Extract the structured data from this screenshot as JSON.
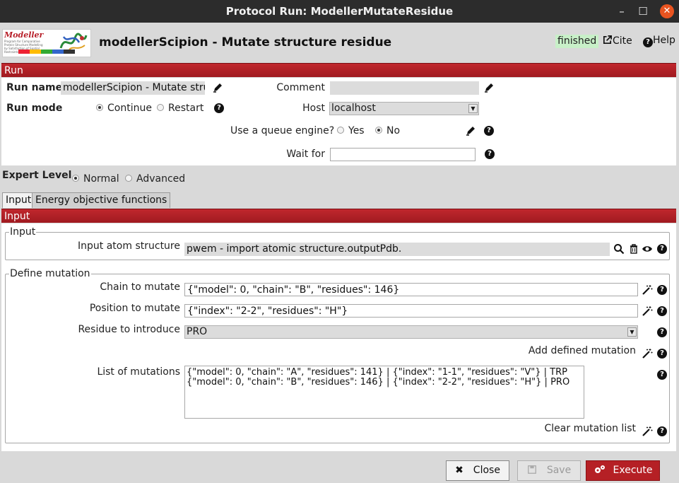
{
  "window": {
    "title": "Protocol Run: ModellerMutateResidue",
    "minimize_glyph": "–",
    "maximize_glyph": "☐",
    "close_glyph": "✕"
  },
  "header": {
    "logo_text": "Modeller",
    "logo_subtext": "Program for Comparative Protein Structure Modelling by Satisfaction of Spatial Restraints",
    "protocol_title": "modellerScipion - Mutate structure residue",
    "status": "finished",
    "cite_label": "Cite",
    "help_label": "Help"
  },
  "run": {
    "section_label": "Run",
    "run_name_label": "Run name",
    "run_name_value": "modellerScipion - Mutate structure residue",
    "comment_label": "Comment",
    "comment_value": "",
    "run_mode_label": "Run mode",
    "run_mode_options": [
      "Continue",
      "Restart"
    ],
    "run_mode_selected": "Continue",
    "host_label": "Host",
    "host_value": "localhost",
    "queue_label": "Use a queue engine?",
    "queue_options": [
      "Yes",
      "No"
    ],
    "queue_selected": "No",
    "wait_for_label": "Wait for",
    "wait_for_value": ""
  },
  "expert": {
    "label": "Expert Level",
    "options": [
      "Normal",
      "Advanced"
    ],
    "selected": "Normal"
  },
  "tabs": [
    {
      "label": "Input",
      "active": true
    },
    {
      "label": "Energy objective functions",
      "active": false
    }
  ],
  "input_section": {
    "section_label": "Input",
    "group_label": "Input",
    "atom_structure_label": "Input atom structure",
    "atom_structure_value": "pwem - import atomic structure.outputPdb."
  },
  "mutation": {
    "group_label": "Define mutation",
    "chain_label": "Chain to mutate",
    "chain_value": "{\"model\": 0, \"chain\": \"B\", \"residues\": 146}",
    "position_label": "Position to mutate",
    "position_value": "{\"index\": \"2-2\", \"residues\": \"H\"}",
    "residue_label": "Residue to introduce",
    "residue_value": "PRO",
    "add_label": "Add defined mutation",
    "list_label": "List of mutations",
    "list_value": "{\"model\": 0, \"chain\": \"A\", \"residues\": 141} | {\"index\": \"1-1\", \"residues\": \"V\"} | TRP\n{\"model\": 0, \"chain\": \"B\", \"residues\": 146} | {\"index\": \"2-2\", \"residues\": \"H\"} | PRO",
    "clear_label": "Clear mutation list"
  },
  "footer": {
    "close_label": "Close",
    "save_label": "Save",
    "execute_label": "Execute"
  },
  "colors": {
    "section_red": "#b52025",
    "status_green": "#c8f0c8",
    "titlebar": "#2c2c2c",
    "close_orange": "#e95420"
  }
}
